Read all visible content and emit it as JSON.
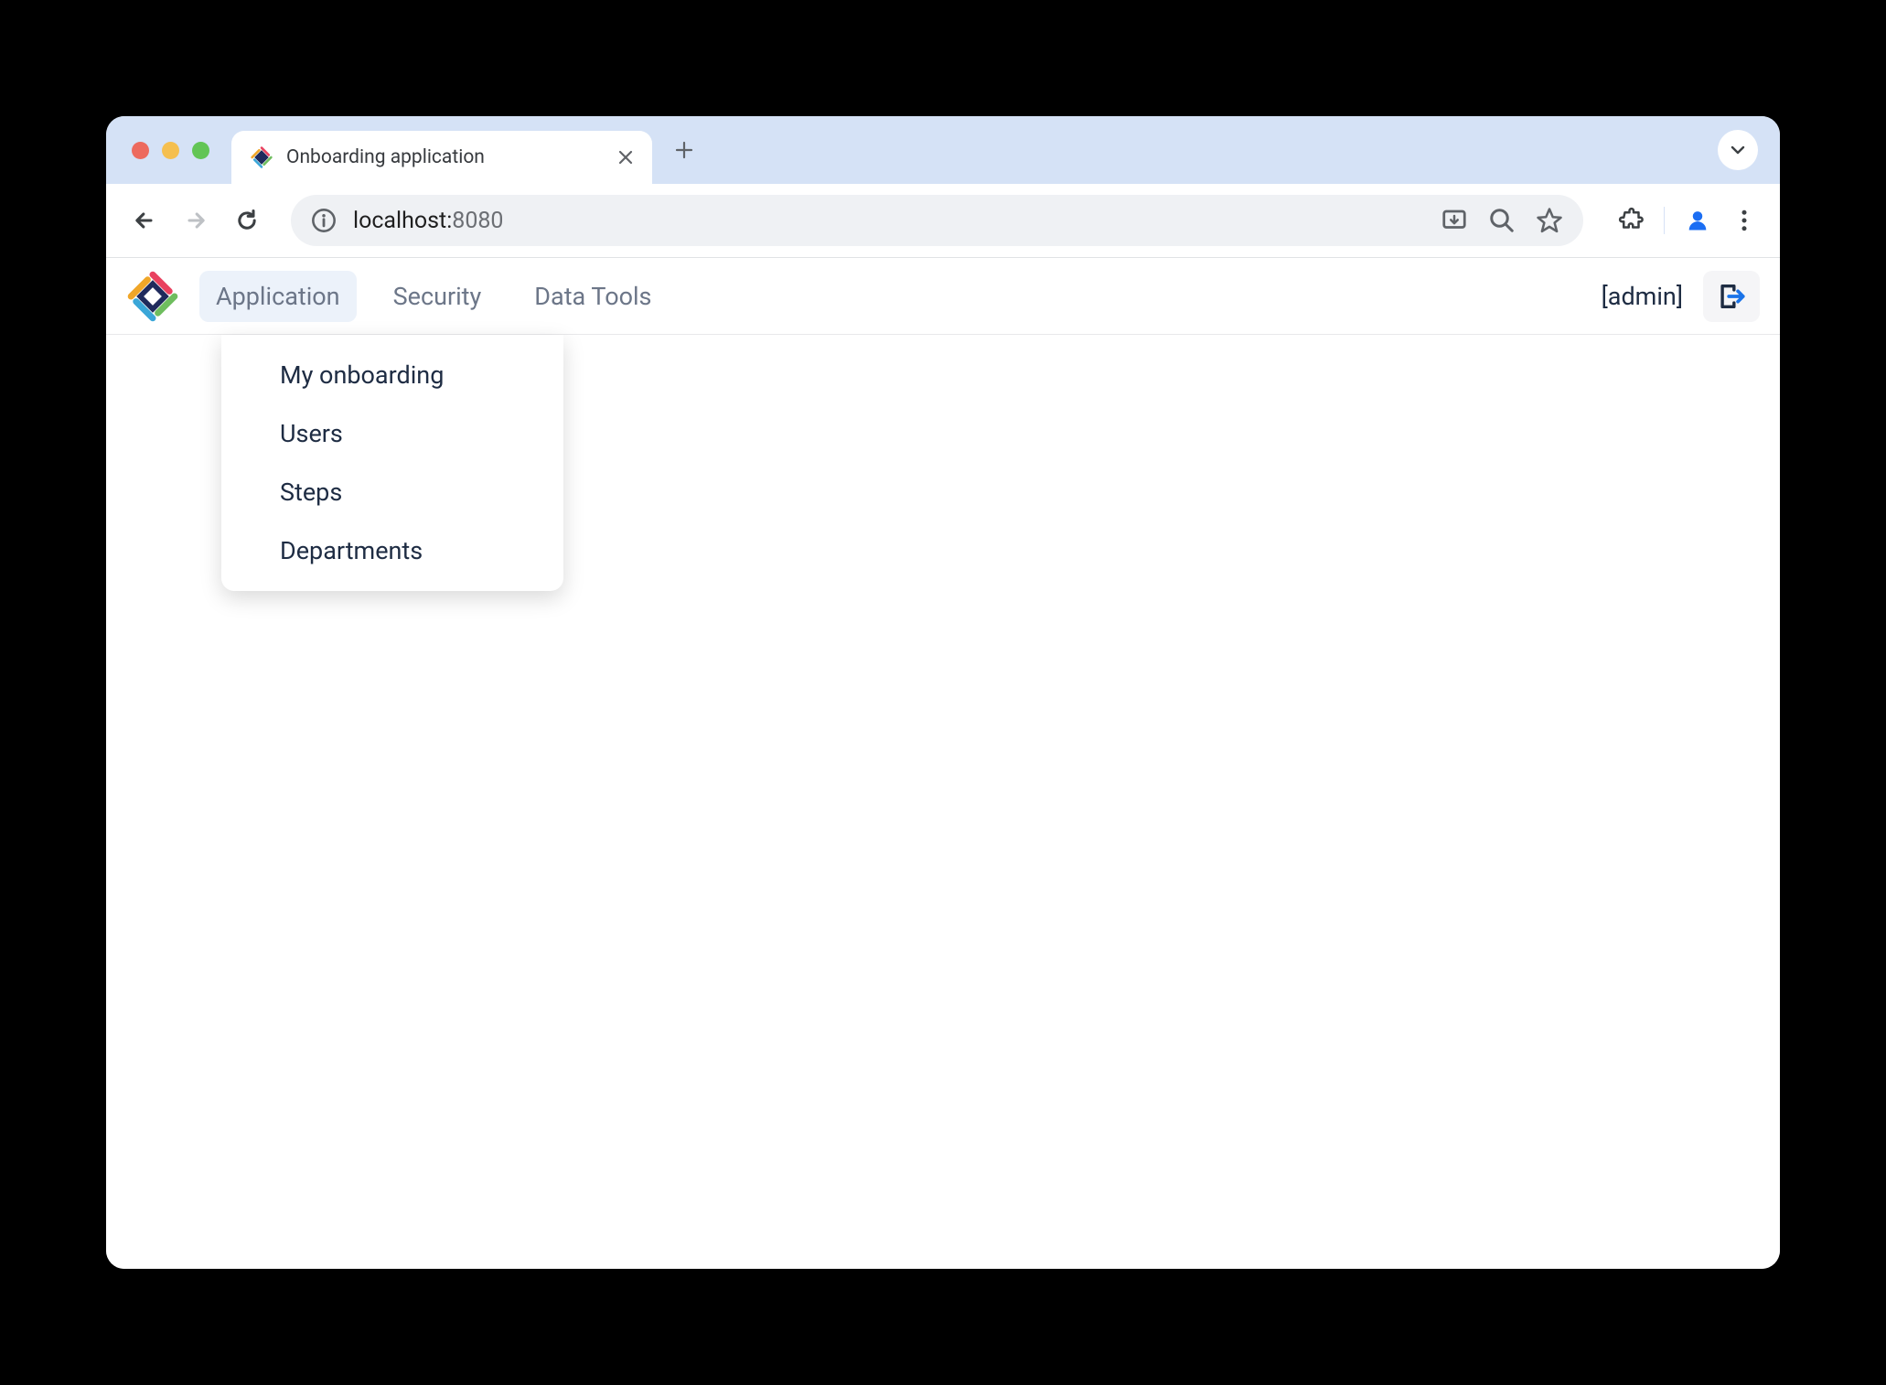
{
  "browser": {
    "tab_title": "Onboarding application",
    "url_host": "localhost:",
    "url_port": "8080"
  },
  "header": {
    "menus": [
      {
        "label": "Application",
        "active": true
      },
      {
        "label": "Security",
        "active": false
      },
      {
        "label": "Data Tools",
        "active": false
      }
    ],
    "user_label": "[admin]"
  },
  "dropdown": {
    "items": [
      "My onboarding",
      "Users",
      "Steps",
      "Departments"
    ]
  }
}
